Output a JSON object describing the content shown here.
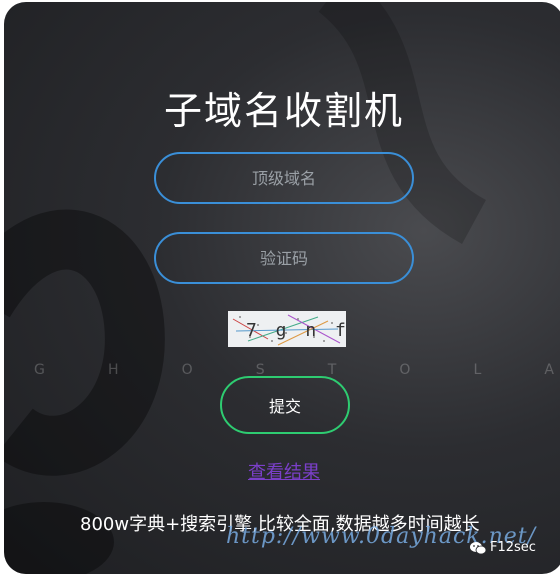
{
  "page": {
    "title": "子域名收割机",
    "domain_placeholder": "顶级域名",
    "captcha_placeholder": "验证码",
    "captcha_text": "7 g n f",
    "watermark_letters": [
      "G",
      "H",
      "O",
      "S",
      "T",
      "O",
      "L",
      "A"
    ],
    "submit_label": "提交",
    "results_link": "查看结果",
    "description": "800w字典+搜索引擎,比较全面,数据越多时间越长",
    "site_watermark": "http://www.0dayhack.net/",
    "brand_label": "F12sec"
  },
  "colors": {
    "field_border": "#3a8fd8",
    "submit_border": "#2ecc71",
    "link": "#7a3fc8"
  }
}
